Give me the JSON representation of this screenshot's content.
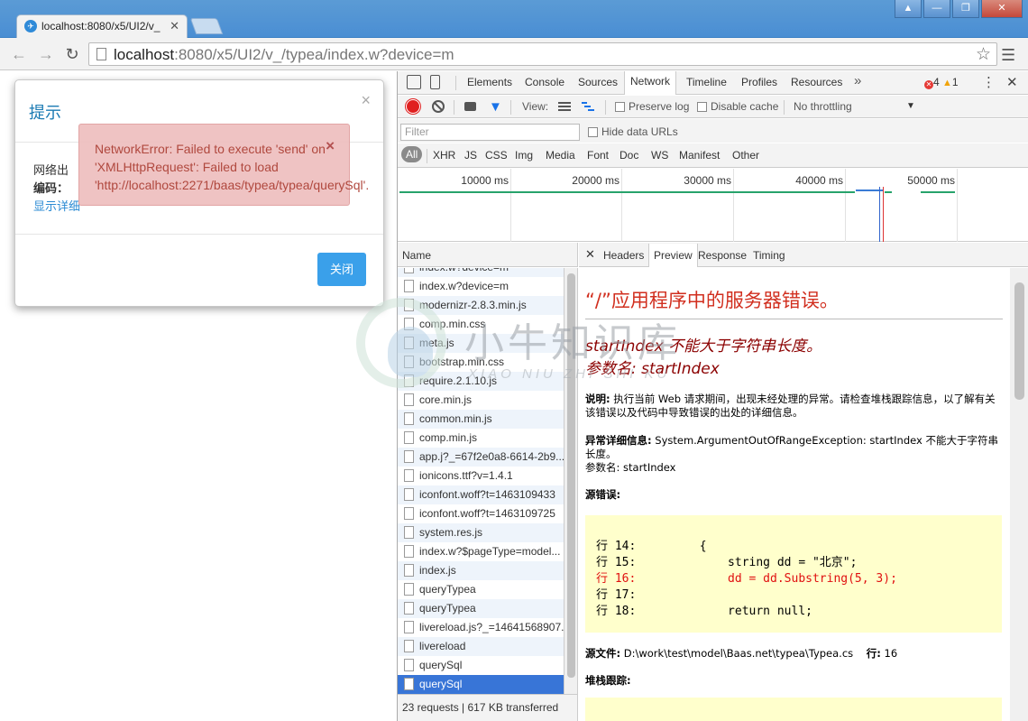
{
  "browser": {
    "tab_title": "localhost:8080/x5/UI2/v_",
    "url_host": "localhost",
    "url_rest": ":8080/x5/UI2/v_/typea/index.w?device=m",
    "window_buttons": [
      "▲",
      "—",
      "❐",
      "✕"
    ]
  },
  "modal": {
    "title": "提示",
    "body_line1": "网络出",
    "body_label": "编码：",
    "detail_link": "显示详细",
    "close_button": "关闭"
  },
  "alert": {
    "message": "NetworkError: Failed to execute 'send' on 'XMLHttpRequest': Failed to load 'http://localhost:2271/baas/typea/typea/querySql'."
  },
  "devtools": {
    "tabs": [
      "Elements",
      "Console",
      "Sources",
      "Network",
      "Timeline",
      "Profiles",
      "Resources"
    ],
    "active_tab": "Network",
    "error_count": "4",
    "warning_count": "1",
    "view_label": "View:",
    "preserve_log": "Preserve log",
    "disable_cache": "Disable cache",
    "throttling": "No throttling",
    "filter_placeholder": "Filter",
    "hide_data_urls": "Hide data URLs",
    "types": [
      "All",
      "XHR",
      "JS",
      "CSS",
      "Img",
      "Media",
      "Font",
      "Doc",
      "WS",
      "Manifest",
      "Other"
    ],
    "timeline_labels": [
      "10000 ms",
      "20000 ms",
      "30000 ms",
      "40000 ms",
      "50000 ms"
    ],
    "name_header": "Name",
    "requests": [
      "index.w?device=m",
      "index.w?device=m",
      "modernizr-2.8.3.min.js",
      "comp.min.css",
      "meta.js",
      "bootstrap.min.css",
      "require.2.1.10.js",
      "core.min.js",
      "common.min.js",
      "comp.min.js",
      "app.j?_=67f2e0a8-6614-2b9...",
      "ionicons.ttf?v=1.4.1",
      "iconfont.woff?t=1463109433",
      "iconfont.woff?t=1463109725",
      "system.res.js",
      "index.w?$pageType=model...",
      "index.js",
      "queryTypea",
      "queryTypea",
      "livereload.js?_=14641568907...",
      "livereload",
      "querySql",
      "querySql"
    ],
    "selected_index": 22,
    "status": "23 requests  |  617 KB transferred",
    "detail_tabs": [
      "Headers",
      "Preview",
      "Response",
      "Timing"
    ],
    "active_detail_tab": "Preview"
  },
  "preview": {
    "title": "“/”应用程序中的服务器错误。",
    "heading_line1": "startIndex 不能大于字符串长度。",
    "heading_line2": "参数名: startIndex",
    "desc_label": "说明:",
    "desc_text": " 执行当前 Web 请求期间，出现未经处理的异常。请检查堆栈跟踪信息，以了解有关该错误以及代码中导致错误的出处的详细信息。",
    "exception_label": "异常详细信息:",
    "exception_text": " System.ArgumentOutOfRangeException: startIndex 不能大于字符串长度。",
    "exception_param": "参数名: startIndex",
    "source_error_label": "源错误:",
    "code_lines": [
      {
        "text": "行 14:         {",
        "error": false
      },
      {
        "text": "行 15:             string dd = \"北京\";",
        "error": false
      },
      {
        "text": "行 16:             dd = dd.Substring(5, 3);",
        "error": true
      },
      {
        "text": "行 17:",
        "error": false
      },
      {
        "text": "行 18:             return null;",
        "error": false
      }
    ],
    "source_file_label": "源文件:",
    "source_file_path": " D:\\work\\test\\model\\Baas.net\\typea\\Typea.cs",
    "line_label": "行:",
    "line_number": " 16",
    "stack_label": "堆栈跟踪:"
  },
  "watermark": {
    "big": "小牛知识库",
    "small": "XIAO NIU ZHI SHI KU"
  }
}
